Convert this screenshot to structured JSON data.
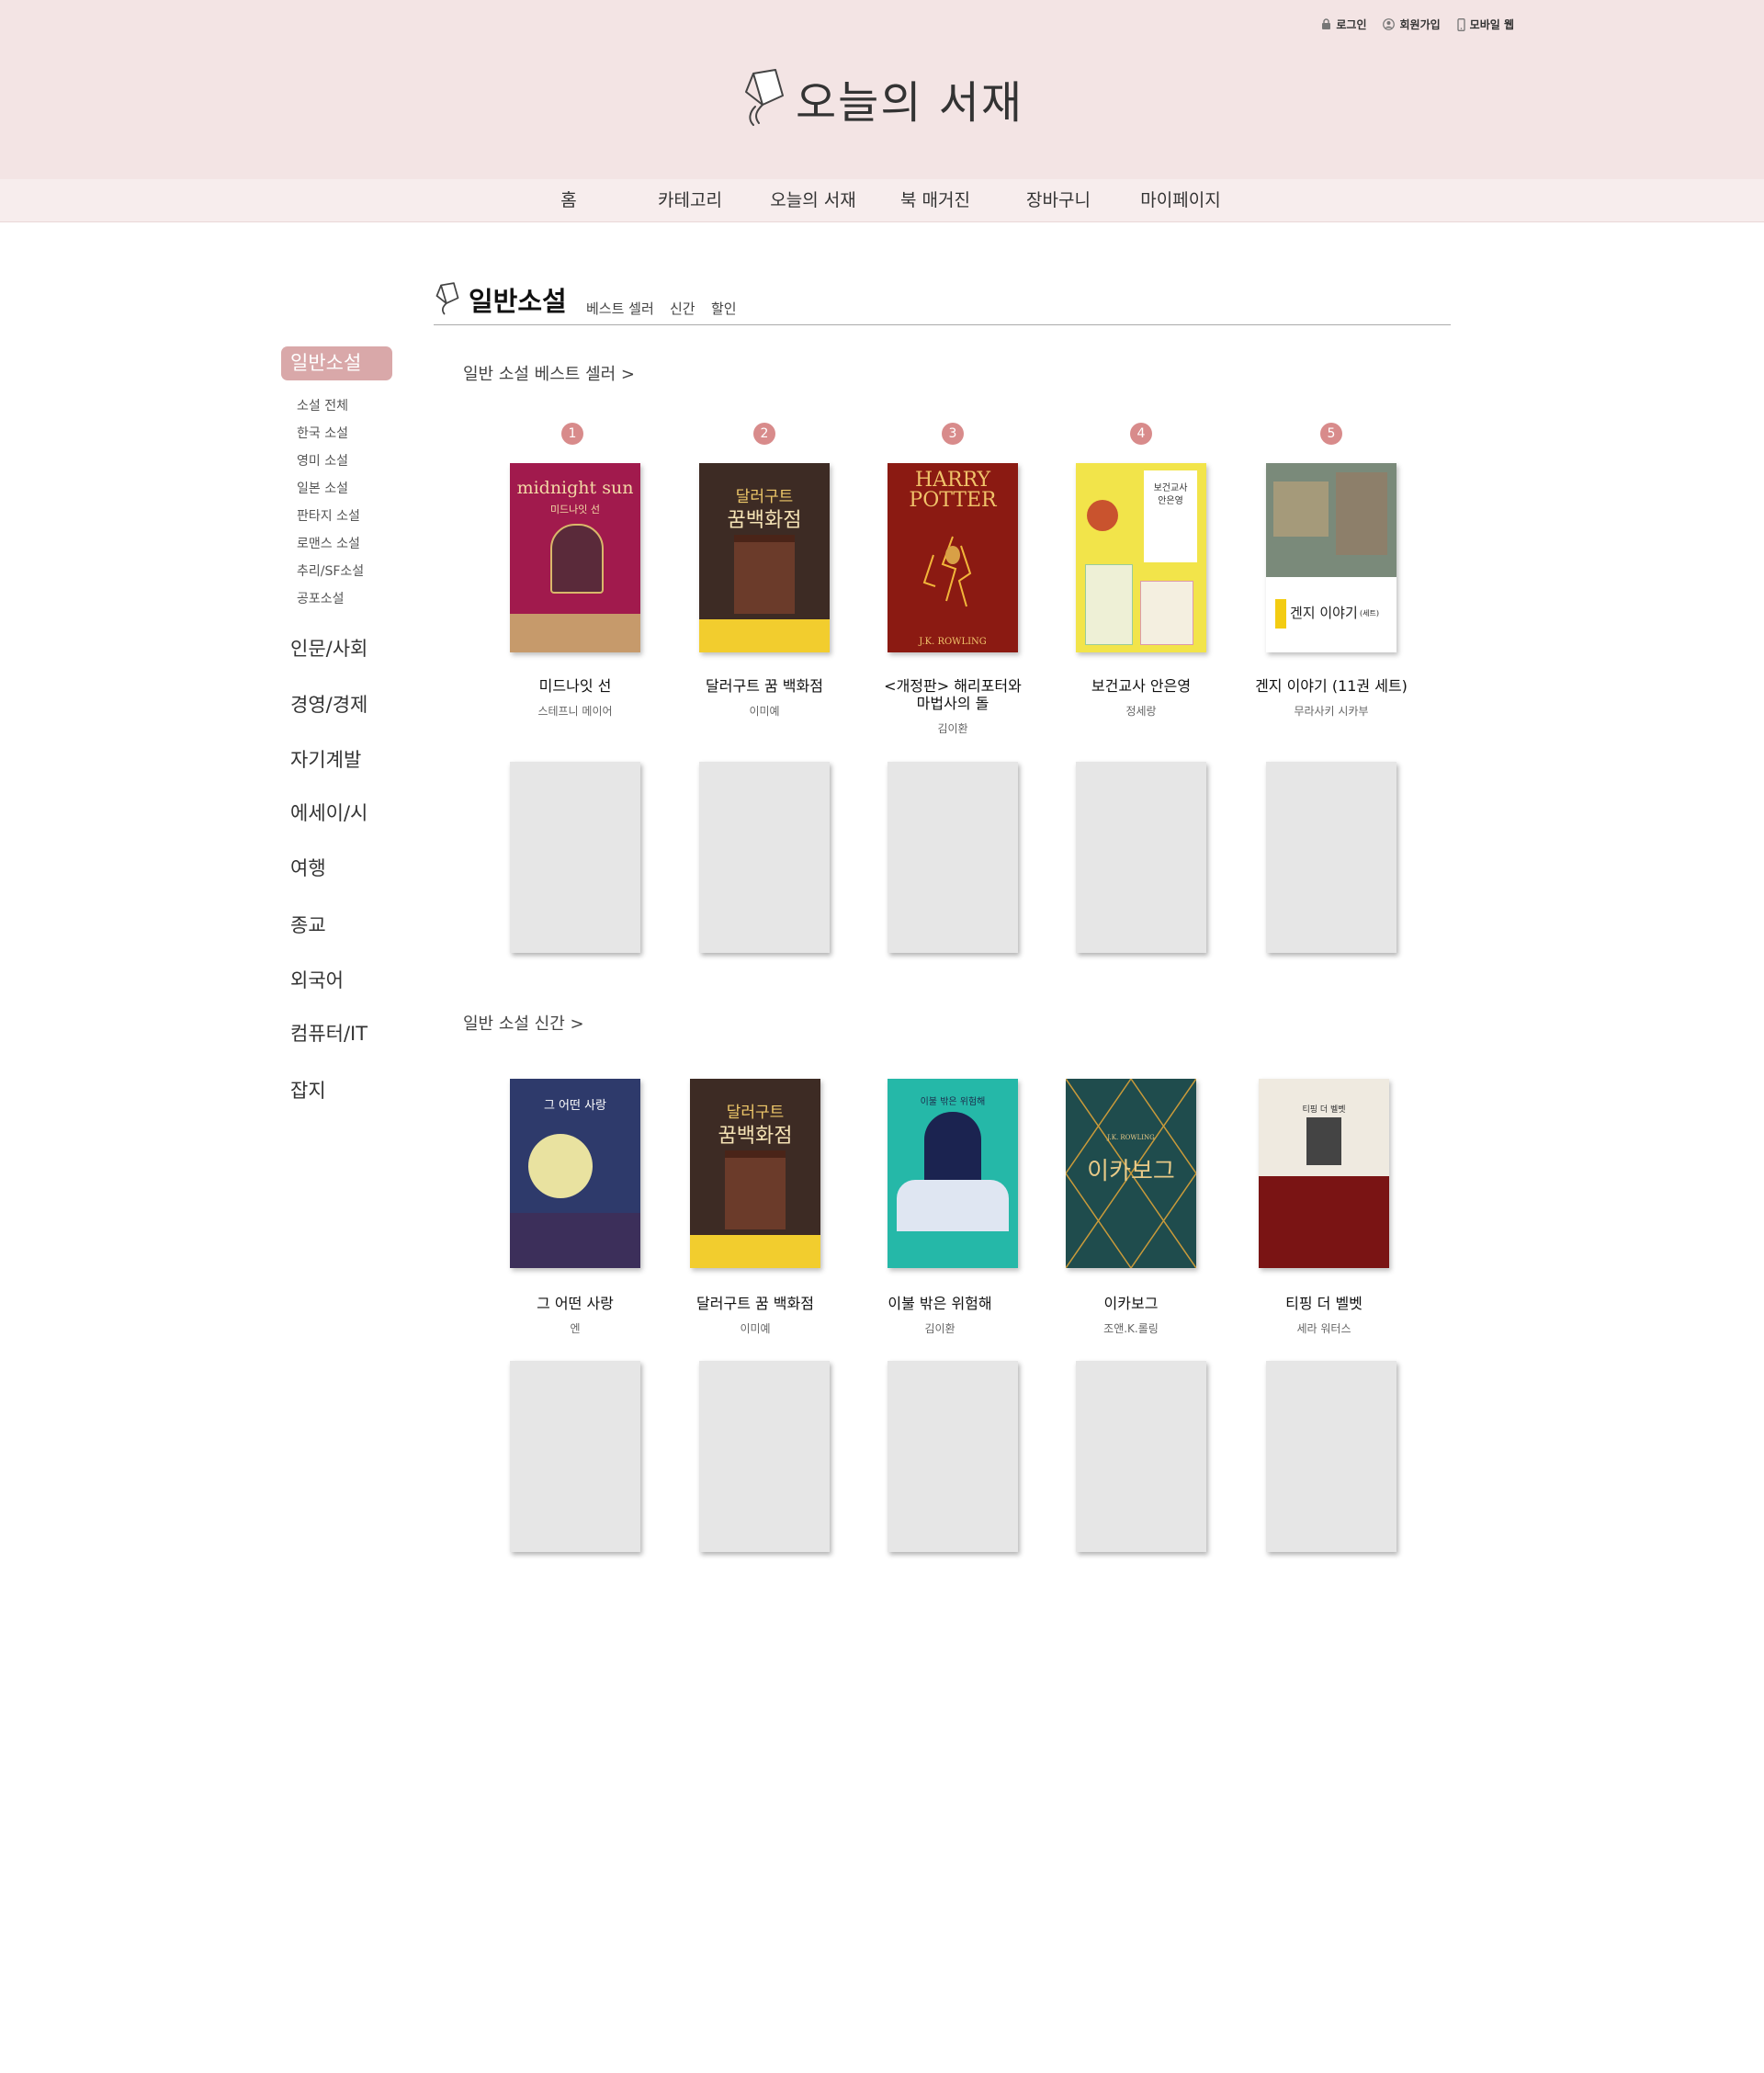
{
  "header": {
    "util": [
      {
        "icon": "lock-icon",
        "label": "로그인"
      },
      {
        "icon": "user-icon",
        "label": "회원가입"
      },
      {
        "icon": "mobile-icon",
        "label": "모바일 웹"
      }
    ],
    "logo_text": "오늘의 서재"
  },
  "nav": [
    "홈",
    "카테고리",
    "오늘의 서재",
    "북 매거진",
    "장바구니",
    "마이페이지"
  ],
  "sidebar": {
    "active": "일반소설",
    "sub": [
      "소설 전체",
      "한국 소설",
      "영미 소설",
      "일본 소설",
      "판타지 소설",
      "로맨스 소설",
      "추리/SF소설",
      "공포소설"
    ],
    "categories": [
      "인문/사회",
      "경영/경제",
      "자기계발",
      "에세이/시",
      "여행",
      "종교",
      "외국어",
      "컴퓨터/IT",
      "잡지"
    ]
  },
  "section": {
    "title": "일반소설",
    "tabs": [
      "베스트 셀러",
      "신간",
      "할인"
    ]
  },
  "bestseller": {
    "title": "일반 소설 베스트 셀러  >",
    "books": [
      {
        "rank": "1",
        "title": "미드나잇 선",
        "author": "스테프니 메이어",
        "cover_title": "midnight sun",
        "cover_sub": "미드나잇 선"
      },
      {
        "rank": "2",
        "title": "달러구트 꿈 백화점",
        "author": "이미예",
        "cover_title": "달러구트",
        "cover_sub": "꿈백화점"
      },
      {
        "rank": "3",
        "title": "<개정판> 해리포터와 마법사의 돌",
        "author": "김이환",
        "cover_title": "HARRY POTTER",
        "cover_sub": "J.K. ROWLING"
      },
      {
        "rank": "4",
        "title": "보건교사 안은영",
        "author": "정세랑",
        "cover_title": "보건교사",
        "cover_sub": "안은영"
      },
      {
        "rank": "5",
        "title": "겐지 이야기 (11권 세트)",
        "author": "무라사키 시카부",
        "cover_title": "겐지 이야기",
        "cover_sub": "(세트)"
      }
    ]
  },
  "new_releases": {
    "title": "일반 소설 신간  >",
    "books": [
      {
        "title": "그 어떤 사랑",
        "author": "엔",
        "cover_title": "그 어떤 사랑"
      },
      {
        "title": "달러구트 꿈 백화점",
        "author": "이미예",
        "cover_title": "달러구트",
        "cover_sub": "꿈백화점"
      },
      {
        "title": "이불 밖은 위험해",
        "author": "김이환",
        "cover_title": "이불 밖은 위험해"
      },
      {
        "title": "이카보그",
        "author": "조앤.K.롤링",
        "cover_title": "이카보그",
        "cover_sub": "J.K. ROWLING"
      },
      {
        "title": "티핑 더 벨벳",
        "author": "세라 워터스",
        "cover_title": "티핑 더 벨벳"
      }
    ]
  },
  "colors": {
    "header_bg": "#f3e4e4",
    "nav_bg": "#f7eded",
    "accent": "#d9a8a9",
    "rank_badge": "#d88b8b",
    "placeholder": "#e6e6e6"
  }
}
